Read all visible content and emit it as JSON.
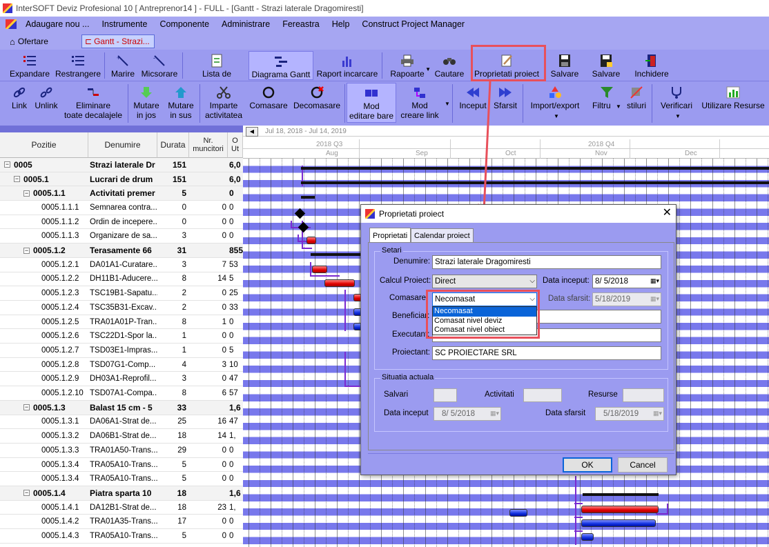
{
  "window": {
    "title": "InterSOFT Deviz Profesional 10 [ Antreprenor14 ] - FULL - [Gantt - Strazi laterale Dragomiresti]"
  },
  "menu": [
    "Adaugare nou ...",
    "Instrumente",
    "Componente",
    "Administrare",
    "Fereastra",
    "Help",
    "Construct Project Manager"
  ],
  "doc_tabs": {
    "ofertare": "Ofertare",
    "gantt": "Gantt - Strazi..."
  },
  "toolbar1": {
    "expandare": "Expandare",
    "restrangere": "Restrangere",
    "marire": "Marire",
    "micsorare": "Micsorare",
    "lista_resurse": "Lista de resurse",
    "diagrama_gantt": "Diagrama Gantt",
    "raport_incarcare": "Raport incarcare",
    "rapoarte": "Rapoarte",
    "cautare": "Cautare",
    "proprietati": "Proprietati proiect",
    "salvare": "Salvare",
    "salvare_ca": "Salvare ca...",
    "inchidere": "Inchidere"
  },
  "toolbar2": {
    "link": "Link",
    "unlink": "Unlink",
    "elim1": "Eliminare",
    "elim2": "toate decalajele",
    "mj1": "Mutare",
    "mj2": "in jos",
    "ms1": "Mutare",
    "ms2": "in sus",
    "imp1": "Imparte",
    "imp2": "activitatea",
    "comasare": "Comasare",
    "decomasare": "Decomasare",
    "me1": "Mod",
    "me2": "editare bare",
    "mc1": "Mod",
    "mc2": "creare link",
    "inceput": "Inceput",
    "sfarsit": "Sfarsit",
    "import": "Import/export",
    "filtru": "Filtru",
    "stiluri": "stiluri",
    "verificari": "Verificari",
    "utilizare": "Utilizare Resurse"
  },
  "grid_headers": {
    "pozitie": "Pozitie",
    "denumire": "Denumire",
    "durata": "Durata",
    "nr1": "Nr.",
    "nr2": "muncitori",
    "o1": "O",
    "o2": "Ut"
  },
  "rows": [
    {
      "poz": "0005",
      "den": "Strazi laterale Dr",
      "dur": "151",
      "nr": "",
      "o": "6,0",
      "level": 0,
      "sum": true
    },
    {
      "poz": "0005.1",
      "den": "Lucrari de drum",
      "dur": "151",
      "nr": "",
      "o": "6,0",
      "level": 1,
      "sum": true
    },
    {
      "poz": "0005.1.1",
      "den": "Activitati premer",
      "dur": "5",
      "nr": "",
      "o": "0",
      "level": 2,
      "sum": true
    },
    {
      "poz": "0005.1.1.1",
      "den": "Semnarea contra...",
      "dur": "0",
      "nr": "0",
      "o": "0",
      "level": 3
    },
    {
      "poz": "0005.1.1.2",
      "den": "Ordin de incepere...",
      "dur": "0",
      "nr": "0",
      "o": "0",
      "level": 3
    },
    {
      "poz": "0005.1.1.3",
      "den": "Organizare de sa...",
      "dur": "3",
      "nr": "0",
      "o": "0",
      "level": 3
    },
    {
      "poz": "0005.1.2",
      "den": "Terasamente 66",
      "dur": "31",
      "nr": "",
      "o": "855",
      "level": 2,
      "sum": true
    },
    {
      "poz": "0005.1.2.1",
      "den": "DA01A1-Curatare...",
      "dur": "3",
      "nr": "7",
      "o": "53",
      "level": 3
    },
    {
      "poz": "0005.1.2.2",
      "den": "DH11B1-Aducere...",
      "dur": "8",
      "nr": "14",
      "o": "5",
      "level": 3
    },
    {
      "poz": "0005.1.2.3",
      "den": "TSC19B1-Sapatu...",
      "dur": "2",
      "nr": "0",
      "o": "25",
      "level": 3
    },
    {
      "poz": "0005.1.2.4",
      "den": "TSC35B31-Excav...",
      "dur": "2",
      "nr": "0",
      "o": "33",
      "level": 3
    },
    {
      "poz": "0005.1.2.5",
      "den": "TRA01A01P-Tran...",
      "dur": "8",
      "nr": "1",
      "o": "0",
      "level": 3
    },
    {
      "poz": "0005.1.2.6",
      "den": "TSC22D1-Spor la...",
      "dur": "1",
      "nr": "0",
      "o": "0",
      "level": 3
    },
    {
      "poz": "0005.1.2.7",
      "den": "TSD03E1-Impras...",
      "dur": "1",
      "nr": "0",
      "o": "5",
      "level": 3
    },
    {
      "poz": "0005.1.2.8",
      "den": "TSD07G1-Comp...",
      "dur": "4",
      "nr": "3",
      "o": "10",
      "level": 3
    },
    {
      "poz": "0005.1.2.9",
      "den": "DH03A1-Reprofil...",
      "dur": "3",
      "nr": "0",
      "o": "47",
      "level": 3
    },
    {
      "poz": "0005.1.2.10",
      "den": "TSD07A1-Compa...",
      "dur": "8",
      "nr": "6",
      "o": "57",
      "level": 3
    },
    {
      "poz": "0005.1.3",
      "den": "Balast 15 cm - 5",
      "dur": "33",
      "nr": "",
      "o": "1,6",
      "level": 2,
      "sum": true
    },
    {
      "poz": "0005.1.3.1",
      "den": "DA06A1-Strat de...",
      "dur": "25",
      "nr": "16",
      "o": "47",
      "level": 3
    },
    {
      "poz": "0005.1.3.2",
      "den": "DA06B1-Strat de...",
      "dur": "18",
      "nr": "14",
      "o": "1,",
      "level": 3
    },
    {
      "poz": "0005.1.3.3",
      "den": "TRA01A50-Trans...",
      "dur": "29",
      "nr": "0",
      "o": "0",
      "level": 3
    },
    {
      "poz": "0005.1.3.4",
      "den": "TRA05A10-Trans...",
      "dur": "5",
      "nr": "0",
      "o": "0",
      "level": 3
    },
    {
      "poz": "0005.1.3.4",
      "den": "TRA05A10-Trans...",
      "dur": "5",
      "nr": "0",
      "o": "0",
      "level": 3
    },
    {
      "poz": "0005.1.4",
      "den": "Piatra sparta 10",
      "dur": "18",
      "nr": "",
      "o": "1,6",
      "level": 2,
      "sum": true
    },
    {
      "poz": "0005.1.4.1",
      "den": "DA12B1-Strat de...",
      "dur": "18",
      "nr": "23",
      "o": "1,",
      "level": 3
    },
    {
      "poz": "0005.1.4.2",
      "den": "TRA01A35-Trans...",
      "dur": "17",
      "nr": "0",
      "o": "0",
      "level": 3
    },
    {
      "poz": "0005.1.4.3",
      "den": "TRA05A10-Trans...",
      "dur": "5",
      "nr": "0",
      "o": "0",
      "level": 3
    }
  ],
  "gantt": {
    "range": "Jul 18, 2018 - Jul 14, 2019",
    "q1": "2018 Q3",
    "q2": "2018 Q4",
    "months": [
      "Aug",
      "Sep",
      "Oct",
      "Nov",
      "Dec"
    ]
  },
  "dialog": {
    "title": "Proprietati proiect",
    "tab_proprietati": "Proprietati",
    "tab_calendar": "Calendar proiect",
    "group_setari": "Setari",
    "denumire_label": "Denumire:",
    "denumire_value": "Strazi laterale Dragomiresti",
    "calcul_label": "Calcul Proiect:",
    "calcul_value": "Direct",
    "data_inceput_label": "Data inceput:",
    "data_inceput_value": "8/ 5/2018",
    "comasare_label": "Comasare:",
    "comasare_value": "Necomasat",
    "data_sfarsit_label": "Data sfarsit:",
    "data_sfarsit_value": "5/18/2019",
    "comasare_options": [
      "Necomasat",
      "Comasat nivel deviz",
      "Comasat nivel obiect"
    ],
    "beneficiar_label": "Beneficiar:",
    "beneficiar_value": "",
    "executant_label": "Executant:",
    "executant_value": "",
    "proiectant_label": "Proiectant:",
    "proiectant_value": "SC PROIECTARE SRL",
    "group_situatia": "Situatia actuala",
    "salvari_label": "Salvari",
    "activitati_label": "Activitati",
    "resurse_label": "Resurse",
    "sit_data_inceput_label": "Data inceput",
    "sit_data_inceput_value": "8/ 5/2018",
    "sit_data_sfarsit_label": "Data sfarsit",
    "sit_data_sfarsit_value": "5/18/2019",
    "ok": "OK",
    "cancel": "Cancel"
  },
  "colors": {
    "accent_bg": "#9b9bf0",
    "highlight": "#e8505b",
    "bar_red": "#e00000",
    "bar_blue": "#1030e0"
  }
}
